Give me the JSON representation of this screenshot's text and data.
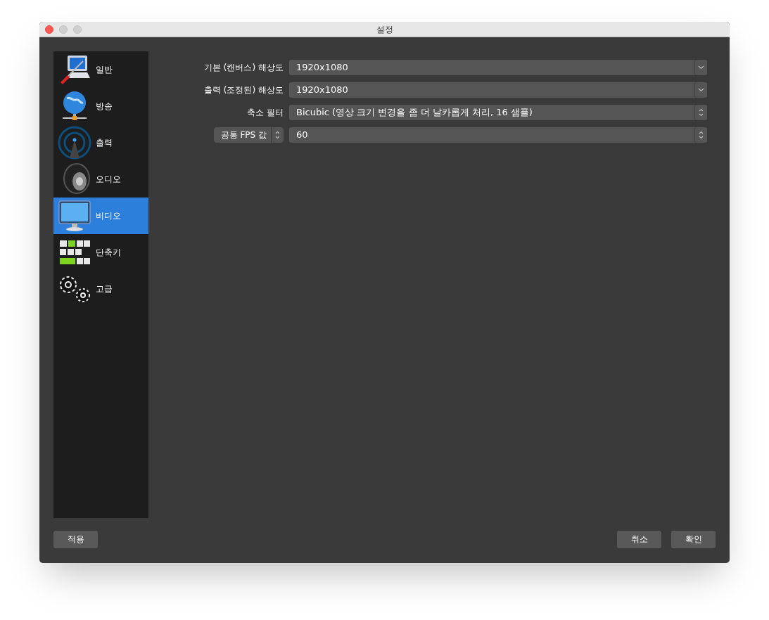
{
  "window": {
    "title": "설정"
  },
  "sidebar": {
    "items": [
      {
        "label": "일반",
        "selected": false
      },
      {
        "label": "방송",
        "selected": false
      },
      {
        "label": "출력",
        "selected": false
      },
      {
        "label": "오디오",
        "selected": false
      },
      {
        "label": "비디오",
        "selected": true
      },
      {
        "label": "단축키",
        "selected": false
      },
      {
        "label": "고급",
        "selected": false
      }
    ]
  },
  "form": {
    "rows": [
      {
        "label": {
          "kind": "text",
          "text": "기본 (캔버스) 해상도"
        },
        "field": {
          "kind": "select",
          "value": "1920x1080"
        }
      },
      {
        "label": {
          "kind": "text",
          "text": "출력 (조정된) 해상도"
        },
        "field": {
          "kind": "select",
          "value": "1920x1080"
        }
      },
      {
        "label": {
          "kind": "text",
          "text": "축소 필터"
        },
        "field": {
          "kind": "stepper",
          "value": "Bicubic (영상 크기 변경을 좀 더 날카롭게 처리, 16 샘플)"
        }
      },
      {
        "label": {
          "kind": "dropdown",
          "text": "공통 FPS 값"
        },
        "field": {
          "kind": "stepper",
          "value": "60"
        }
      }
    ]
  },
  "buttons": {
    "apply": "적용",
    "cancel": "취소",
    "ok": "확인"
  }
}
